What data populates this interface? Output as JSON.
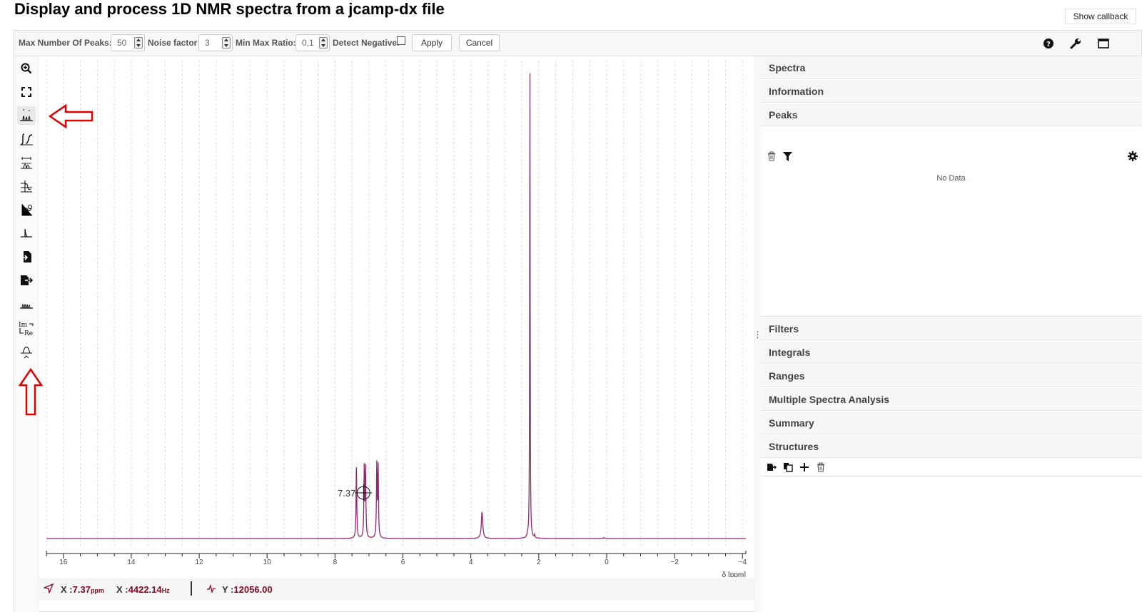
{
  "page": {
    "title": "Display and process 1D NMR spectra from a jcamp-dx file",
    "show_callback_label": "Show callback"
  },
  "toolbar": {
    "max_peaks_label": "Max Number Of Peaks:",
    "max_peaks_value": "50",
    "noise_factor_label": "Noise factor",
    "noise_factor_value": "3",
    "min_max_ratio_label": "Min Max Ratio:",
    "min_max_ratio_value": "0,1",
    "detect_negative_label": "Detect Negative:",
    "detect_negative_checked": false,
    "apply_label": "Apply",
    "cancel_label": "Cancel",
    "right_icons": [
      "help-icon",
      "wrench-icon",
      "fullscreen-icon"
    ]
  },
  "left_tools": [
    {
      "name": "zoom-tool",
      "icon": "zoom-in-icon",
      "active": false
    },
    {
      "name": "full-zoom-out-tool",
      "icon": "expand-icon",
      "active": false
    },
    {
      "name": "peak-picking-tool",
      "icon": "peak-picking-icon",
      "active": true
    },
    {
      "name": "integral-tool",
      "icon": "integral-icon",
      "active": false
    },
    {
      "name": "range-tool",
      "icon": "range-picking-icon",
      "active": false
    },
    {
      "name": "zero-filling-tool",
      "icon": "zero-filling-icon",
      "active": false
    },
    {
      "name": "phase-correction-tool",
      "icon": "phase-correction-icon",
      "active": false
    },
    {
      "name": "baseline-correction-tool",
      "icon": "baseline-correction-icon",
      "active": false
    },
    {
      "name": "import-tool",
      "icon": "import-icon",
      "active": false
    },
    {
      "name": "export-tool",
      "icon": "export-icon",
      "active": false
    },
    {
      "name": "stack-tool",
      "icon": "stack-spectra-icon",
      "active": false
    },
    {
      "name": "real-imaginary-tool",
      "icon": "real-imaginary-icon",
      "active": false
    },
    {
      "name": "auto-peak-tool",
      "icon": "auto-peak-picking-icon",
      "active": false
    }
  ],
  "chart_data": {
    "type": "line",
    "title": "",
    "xlabel": "δ [ppm]",
    "ylabel": "",
    "xlim": [
      16.5,
      -4.1
    ],
    "x_reversed": true,
    "x_ticks": [
      16,
      14,
      12,
      10,
      8,
      6,
      4,
      2,
      0,
      -2,
      -4
    ],
    "grid": "vertical dashed",
    "line_color": "#8b2a6e",
    "ylim": [
      0,
      1
    ],
    "series": [
      {
        "peaks": [
          {
            "ppm": 7.37,
            "height": 0.155,
            "width": 0.012
          },
          {
            "ppm": 7.14,
            "height": 0.145,
            "width": 0.012
          },
          {
            "ppm": 7.1,
            "height": 0.143,
            "width": 0.012
          },
          {
            "ppm": 6.77,
            "height": 0.15,
            "width": 0.012
          },
          {
            "ppm": 6.73,
            "height": 0.148,
            "width": 0.012
          },
          {
            "ppm": 3.67,
            "height": 0.055,
            "width": 0.025
          },
          {
            "ppm": 2.26,
            "height": 1.0,
            "width": 0.008
          },
          {
            "ppm": 2.33,
            "height": 0.006,
            "width": 0.01
          },
          {
            "ppm": 2.12,
            "height": 0.006,
            "width": 0.01
          },
          {
            "ppm": 0.08,
            "height": 0.002,
            "width": 0.02
          }
        ]
      }
    ],
    "annotations": [
      {
        "ppm": 7.37,
        "label": "7.37",
        "marker": "crosshair"
      }
    ]
  },
  "status": {
    "x_label": "X :",
    "x_ppm_value": "7.37",
    "x_ppm_unit": "ppm",
    "x_hz_label": "X :",
    "x_hz_value": "4422.14",
    "x_hz_unit": "Hz",
    "y_label": "Y :",
    "y_value": "12056.00"
  },
  "panels": {
    "spectra": "Spectra",
    "information": "Information",
    "peaks": "Peaks",
    "peaks_empty": "No Data",
    "filters": "Filters",
    "integrals": "Integrals",
    "ranges": "Ranges",
    "multiple_spectra_analysis": "Multiple Spectra Analysis",
    "summary": "Summary",
    "structures": "Structures"
  },
  "colors": {
    "spectrum": "#8b2a6e",
    "status_value": "#7a0c22",
    "annotation_arrow": "#e00000"
  }
}
